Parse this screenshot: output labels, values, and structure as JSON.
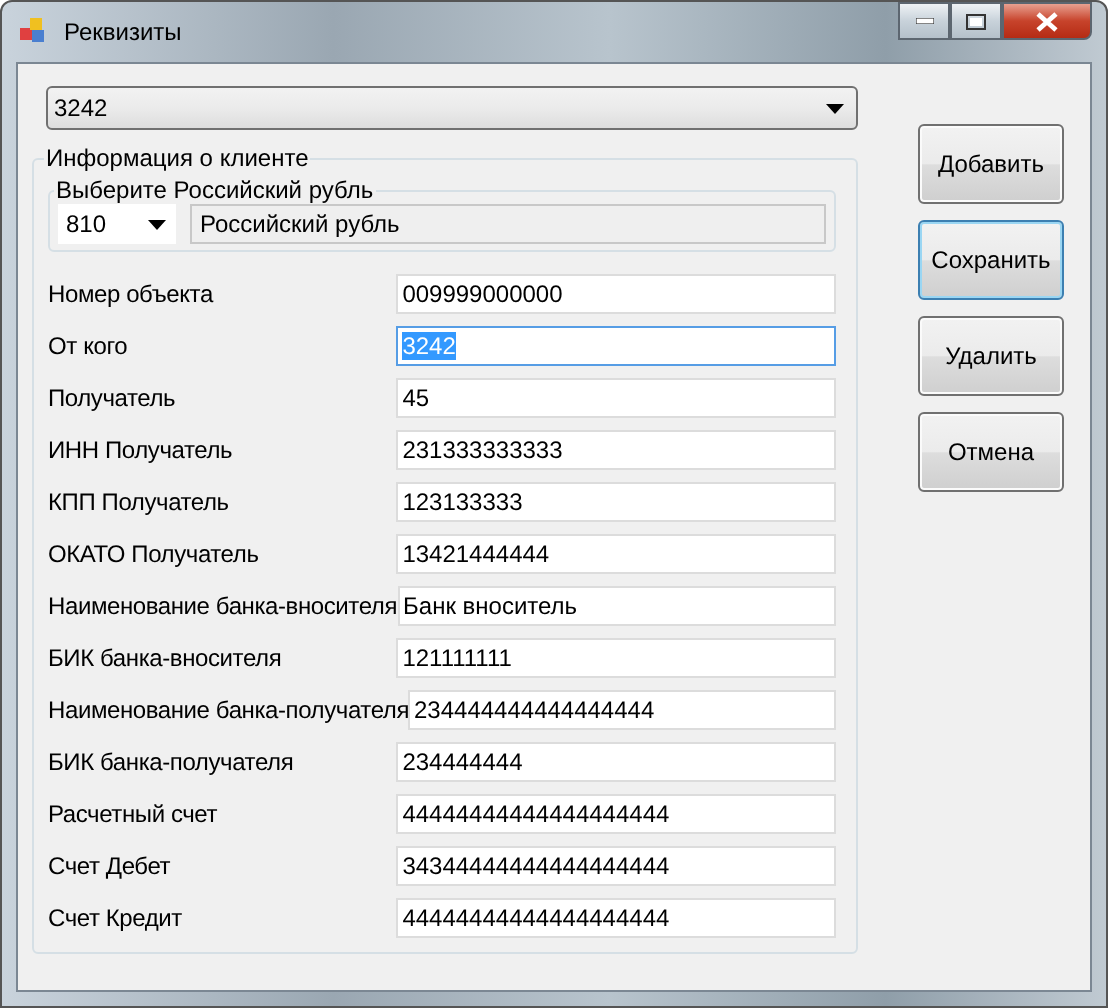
{
  "window": {
    "title": "Реквизиты"
  },
  "record_select": {
    "value": "3242"
  },
  "client_group": {
    "title": "Информация о клиенте",
    "currency_group": {
      "title": "Выберите Российский рубль",
      "code": "810",
      "name": "Российский рубль"
    },
    "fields": [
      {
        "label": "Номер объекта",
        "value": "009999000000",
        "focused": false
      },
      {
        "label": "От кого",
        "value": "3242",
        "focused": true
      },
      {
        "label": "Получатель",
        "value": "45",
        "focused": false
      },
      {
        "label": "ИНН Получатель",
        "value": "231333333333",
        "focused": false
      },
      {
        "label": "КПП Получатель",
        "value": "123133333",
        "focused": false
      },
      {
        "label": "ОКАТО Получатель",
        "value": "13421444444",
        "focused": false
      },
      {
        "label": "Наименование банка-вносителя",
        "value": "Банк вноситель",
        "focused": false
      },
      {
        "label": "БИК банка-вносителя",
        "value": "121111111",
        "focused": false
      },
      {
        "label": "Наименование банка-получателя",
        "value": "234444444444444444",
        "focused": false
      },
      {
        "label": "БИК банка-получателя",
        "value": "234444444",
        "focused": false
      },
      {
        "label": "Расчетный счет",
        "value": "44444444444444444444",
        "focused": false
      },
      {
        "label": "Счет Дебет",
        "value": "34344444444444444444",
        "focused": false
      },
      {
        "label": "Счет Кредит",
        "value": "44444444444444444444",
        "focused": false
      }
    ]
  },
  "buttons": [
    {
      "label": "Добавить",
      "focused": false
    },
    {
      "label": "Сохранить",
      "focused": true
    },
    {
      "label": "Удалить",
      "focused": false
    },
    {
      "label": "Отмена",
      "focused": false
    }
  ]
}
